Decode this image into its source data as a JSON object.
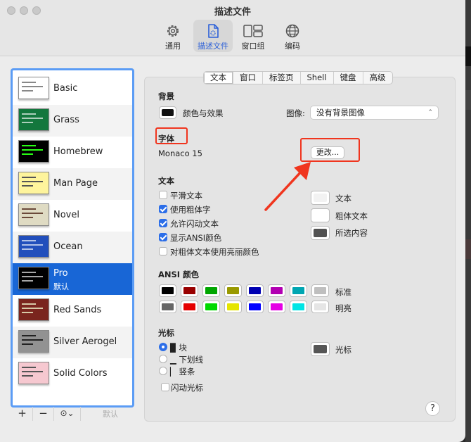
{
  "window": {
    "title": "描述文件"
  },
  "toolbar": [
    {
      "label": "通用",
      "icon": "gear-icon"
    },
    {
      "label": "描述文件",
      "icon": "document-icon"
    },
    {
      "label": "窗口组",
      "icon": "window-group-icon"
    },
    {
      "label": "编码",
      "icon": "globe-icon"
    }
  ],
  "profiles": [
    {
      "name": "Basic",
      "bg": "#ffffff",
      "fg": "#333333"
    },
    {
      "name": "Grass",
      "bg": "#13773d",
      "fg": "#fff0a5"
    },
    {
      "name": "Homebrew",
      "bg": "#000000",
      "fg": "#28fe14"
    },
    {
      "name": "Man Page",
      "bg": "#fef49c",
      "fg": "#000000"
    },
    {
      "name": "Novel",
      "bg": "#dfdbc3",
      "fg": "#3b2322"
    },
    {
      "name": "Ocean",
      "bg": "#224fbc",
      "fg": "#ffffff"
    },
    {
      "name": "Pro",
      "default_label": "默认",
      "bg": "#000000",
      "fg": "#f2f2f2"
    },
    {
      "name": "Red Sands",
      "bg": "#7a251e",
      "fg": "#d7c9a7"
    },
    {
      "name": "Silver Aerogel",
      "bg": "#929292",
      "fg": "#000000"
    },
    {
      "name": "Solid Colors",
      "bg": "#f6c8d0",
      "fg": "#000000"
    }
  ],
  "sidebar_footer": {
    "add": "+",
    "remove": "−",
    "more": "⊙⌄",
    "default": "默认"
  },
  "tabs": [
    "文本",
    "窗口",
    "标签页",
    "Shell",
    "键盘",
    "高级"
  ],
  "background": {
    "heading": "背景",
    "color_effect_label": "颜色与效果",
    "image_label": "图像:",
    "image_value": "没有背景图像"
  },
  "font": {
    "heading": "字体",
    "value": "Monaco 15",
    "change_button": "更改..."
  },
  "text": {
    "heading": "文本",
    "options": [
      {
        "label": "平滑文本",
        "checked": false
      },
      {
        "label": "使用粗体字",
        "checked": true
      },
      {
        "label": "允许闪动文本",
        "checked": true
      },
      {
        "label": "显示ANSI颜色",
        "checked": true
      },
      {
        "label": "对粗体文本使用亮丽颜色",
        "checked": false
      }
    ],
    "colors": [
      {
        "label": "文本",
        "color": "#f2f2f2"
      },
      {
        "label": "粗体文本",
        "color": "#ffffff"
      },
      {
        "label": "所选内容",
        "color": "#515151"
      }
    ]
  },
  "ansi": {
    "heading": "ANSI 颜色",
    "normal_label": "标准",
    "bright_label": "明亮",
    "normal": [
      "#000000",
      "#990000",
      "#00a600",
      "#999900",
      "#0000b2",
      "#b200b2",
      "#00a6b2",
      "#bfbfbf"
    ],
    "bright": [
      "#666666",
      "#e50000",
      "#00d900",
      "#e5e500",
      "#0000ff",
      "#e500e5",
      "#00e5e5",
      "#e5e5e5"
    ]
  },
  "cursor": {
    "heading": "光标",
    "styles": [
      {
        "label": "▉ 块",
        "selected": true
      },
      {
        "label": "▁ 下划线",
        "selected": false
      },
      {
        "label": "▏ 竖条",
        "selected": false
      }
    ],
    "blink_label": "闪动光标",
    "color_label": "光标",
    "color": "#555555"
  },
  "help": "?"
}
